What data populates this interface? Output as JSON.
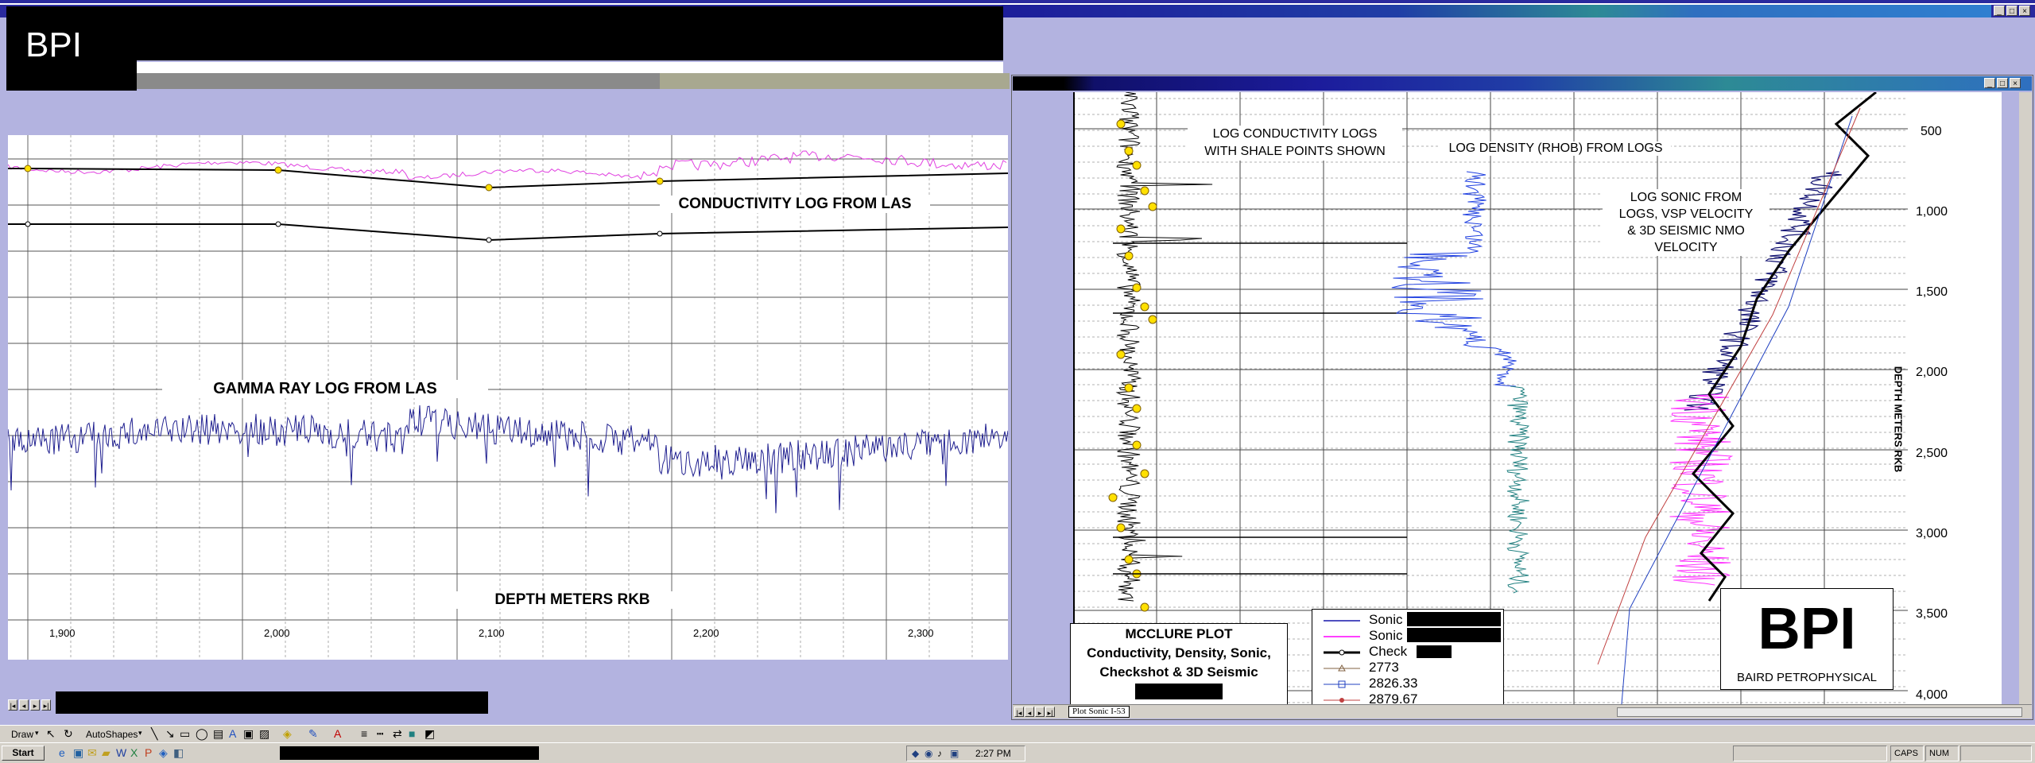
{
  "window": {
    "title_bar_colors": [
      "#1c1c9c",
      "#2a4aa8",
      "#2f6fc0",
      "#2d8a95"
    ],
    "controls": [
      "_",
      "□",
      "×"
    ]
  },
  "left_panel": {
    "logo": "BPI",
    "labels": {
      "conductivity": "CONDUCTIVITY LOG FROM LAS",
      "gamma": "GAMMA RAY LOG FROM LAS",
      "depth": "DEPTH METERS RKB"
    },
    "x_ticks": [
      "1,900",
      "2,000",
      "2,100",
      "2,200",
      "2,300"
    ]
  },
  "right_panel": {
    "labels": {
      "conductivity": "LOG CONDUCTIVITY LOGS\nWITH SHALE POINTS SHOWN",
      "density": "LOG DENSITY (RHOB) FROM LOGS",
      "sonic": "LOG SONIC FROM\nLOGS, VSP VELOCITY\n& 3D SEISMIC NMO\nVELOCITY",
      "depth_axis": "DEPTH METERS RKB"
    },
    "y_ticks": [
      "500",
      "1,000",
      "1,500",
      "2,000",
      "2,500",
      "3,000",
      "3,500",
      "4,000"
    ],
    "mcclure_box": {
      "title": "MCCLURE PLOT",
      "line2": "Conductivity, Density, Sonic,",
      "line3": "Checkshot & 3D Seismic"
    },
    "legend": [
      {
        "label": "Sonic",
        "color": "#5050c0"
      },
      {
        "label": "Sonic",
        "color": "#ff40ff"
      },
      {
        "label": "Check",
        "color": "#000000"
      },
      {
        "label": "2773",
        "color": "#806040"
      },
      {
        "label": "2826.33",
        "color": "#2040c0"
      },
      {
        "label": "2879.67",
        "color": "#c04040"
      }
    ],
    "bpi_box": {
      "logo": "BPI",
      "caption": "BAIRD PETROPHYSICAL"
    },
    "sheet_tab": "Plot Sonic I-53"
  },
  "toolbar": {
    "draw": "Draw",
    "autoshapes": "AutoShapes"
  },
  "taskbar": {
    "start": "Start",
    "clock": "2:27 PM",
    "caps": "CAPS",
    "num": "NUM"
  }
}
